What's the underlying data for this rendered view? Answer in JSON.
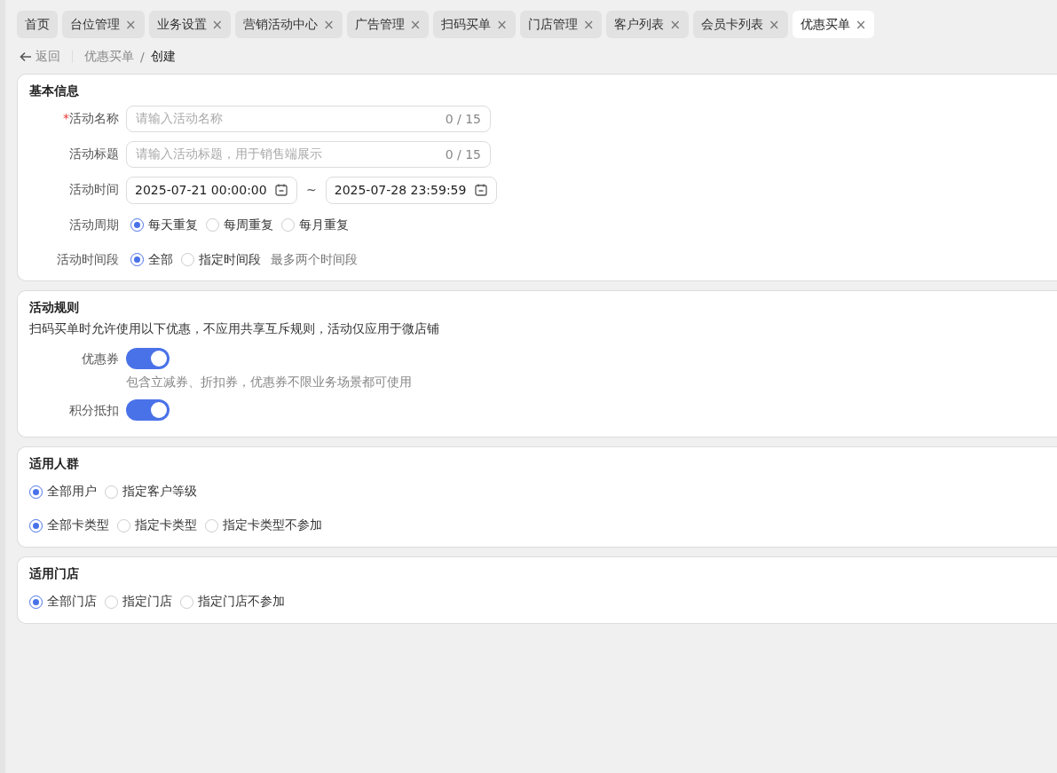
{
  "tabs": [
    {
      "label": "首页",
      "closable": false,
      "selected": false
    },
    {
      "label": "台位管理",
      "closable": true,
      "selected": false
    },
    {
      "label": "业务设置",
      "closable": true,
      "selected": false
    },
    {
      "label": "营销活动中心",
      "closable": true,
      "selected": false
    },
    {
      "label": "广告管理",
      "closable": true,
      "selected": false
    },
    {
      "label": "扫码买单",
      "closable": true,
      "selected": false
    },
    {
      "label": "门店管理",
      "closable": true,
      "selected": false
    },
    {
      "label": "客户列表",
      "closable": true,
      "selected": false
    },
    {
      "label": "会员卡列表",
      "closable": true,
      "selected": false
    },
    {
      "label": "优惠买单",
      "closable": true,
      "selected": true
    }
  ],
  "close_glyph": "×",
  "required_mark": "*",
  "breadcrumb": {
    "back": "返回",
    "items": [
      "优惠买单",
      "创建"
    ],
    "separator": "/"
  },
  "sections": [
    {
      "kind": "form",
      "title": "基本信息",
      "fields": [
        {
          "kind": "input",
          "label": "活动名称",
          "required": true,
          "placeholder": "请输入活动名称",
          "counter": "0 / 15"
        },
        {
          "kind": "input",
          "label": "活动标题",
          "required": false,
          "placeholder": "请输入活动标题，用于销售端展示",
          "counter": "0 / 15"
        },
        {
          "kind": "date_range",
          "label": "活动时间",
          "start": "2025-07-21 00:00:00",
          "separator": "~",
          "end": "2025-07-28 23:59:59"
        },
        {
          "kind": "radio",
          "label": "活动周期",
          "options": [
            {
              "label": "每天重复",
              "selected": true
            },
            {
              "label": "每周重复",
              "selected": false
            },
            {
              "label": "每月重复",
              "selected": false
            }
          ]
        },
        {
          "kind": "radio",
          "label": "活动时间段",
          "hint": "最多两个时间段",
          "options": [
            {
              "label": "全部",
              "selected": true
            },
            {
              "label": "指定时间段",
              "selected": false
            }
          ]
        }
      ]
    },
    {
      "kind": "rules",
      "title": "活动规则",
      "description": "扫码买单时允许使用以下优惠，不应用共享互斥规则，活动仅应用于微店铺",
      "toggles": [
        {
          "label": "优惠券",
          "on": true,
          "hint": "包含立减券、折扣券，优惠券不限业务场景都可使用"
        },
        {
          "label": "积分抵扣",
          "on": true
        }
      ]
    },
    {
      "kind": "choices",
      "title": "适用人群",
      "groups": [
        {
          "options": [
            {
              "label": "全部用户",
              "selected": true
            },
            {
              "label": "指定客户等级",
              "selected": false
            }
          ]
        },
        {
          "options": [
            {
              "label": "全部卡类型",
              "selected": true
            },
            {
              "label": "指定卡类型",
              "selected": false
            },
            {
              "label": "指定卡类型不参加",
              "selected": false
            }
          ]
        }
      ]
    },
    {
      "kind": "choices",
      "title": "适用门店",
      "groups": [
        {
          "options": [
            {
              "label": "全部门店",
              "selected": true
            },
            {
              "label": "指定门店",
              "selected": false
            },
            {
              "label": "指定门店不参加",
              "selected": false
            }
          ]
        }
      ]
    }
  ]
}
